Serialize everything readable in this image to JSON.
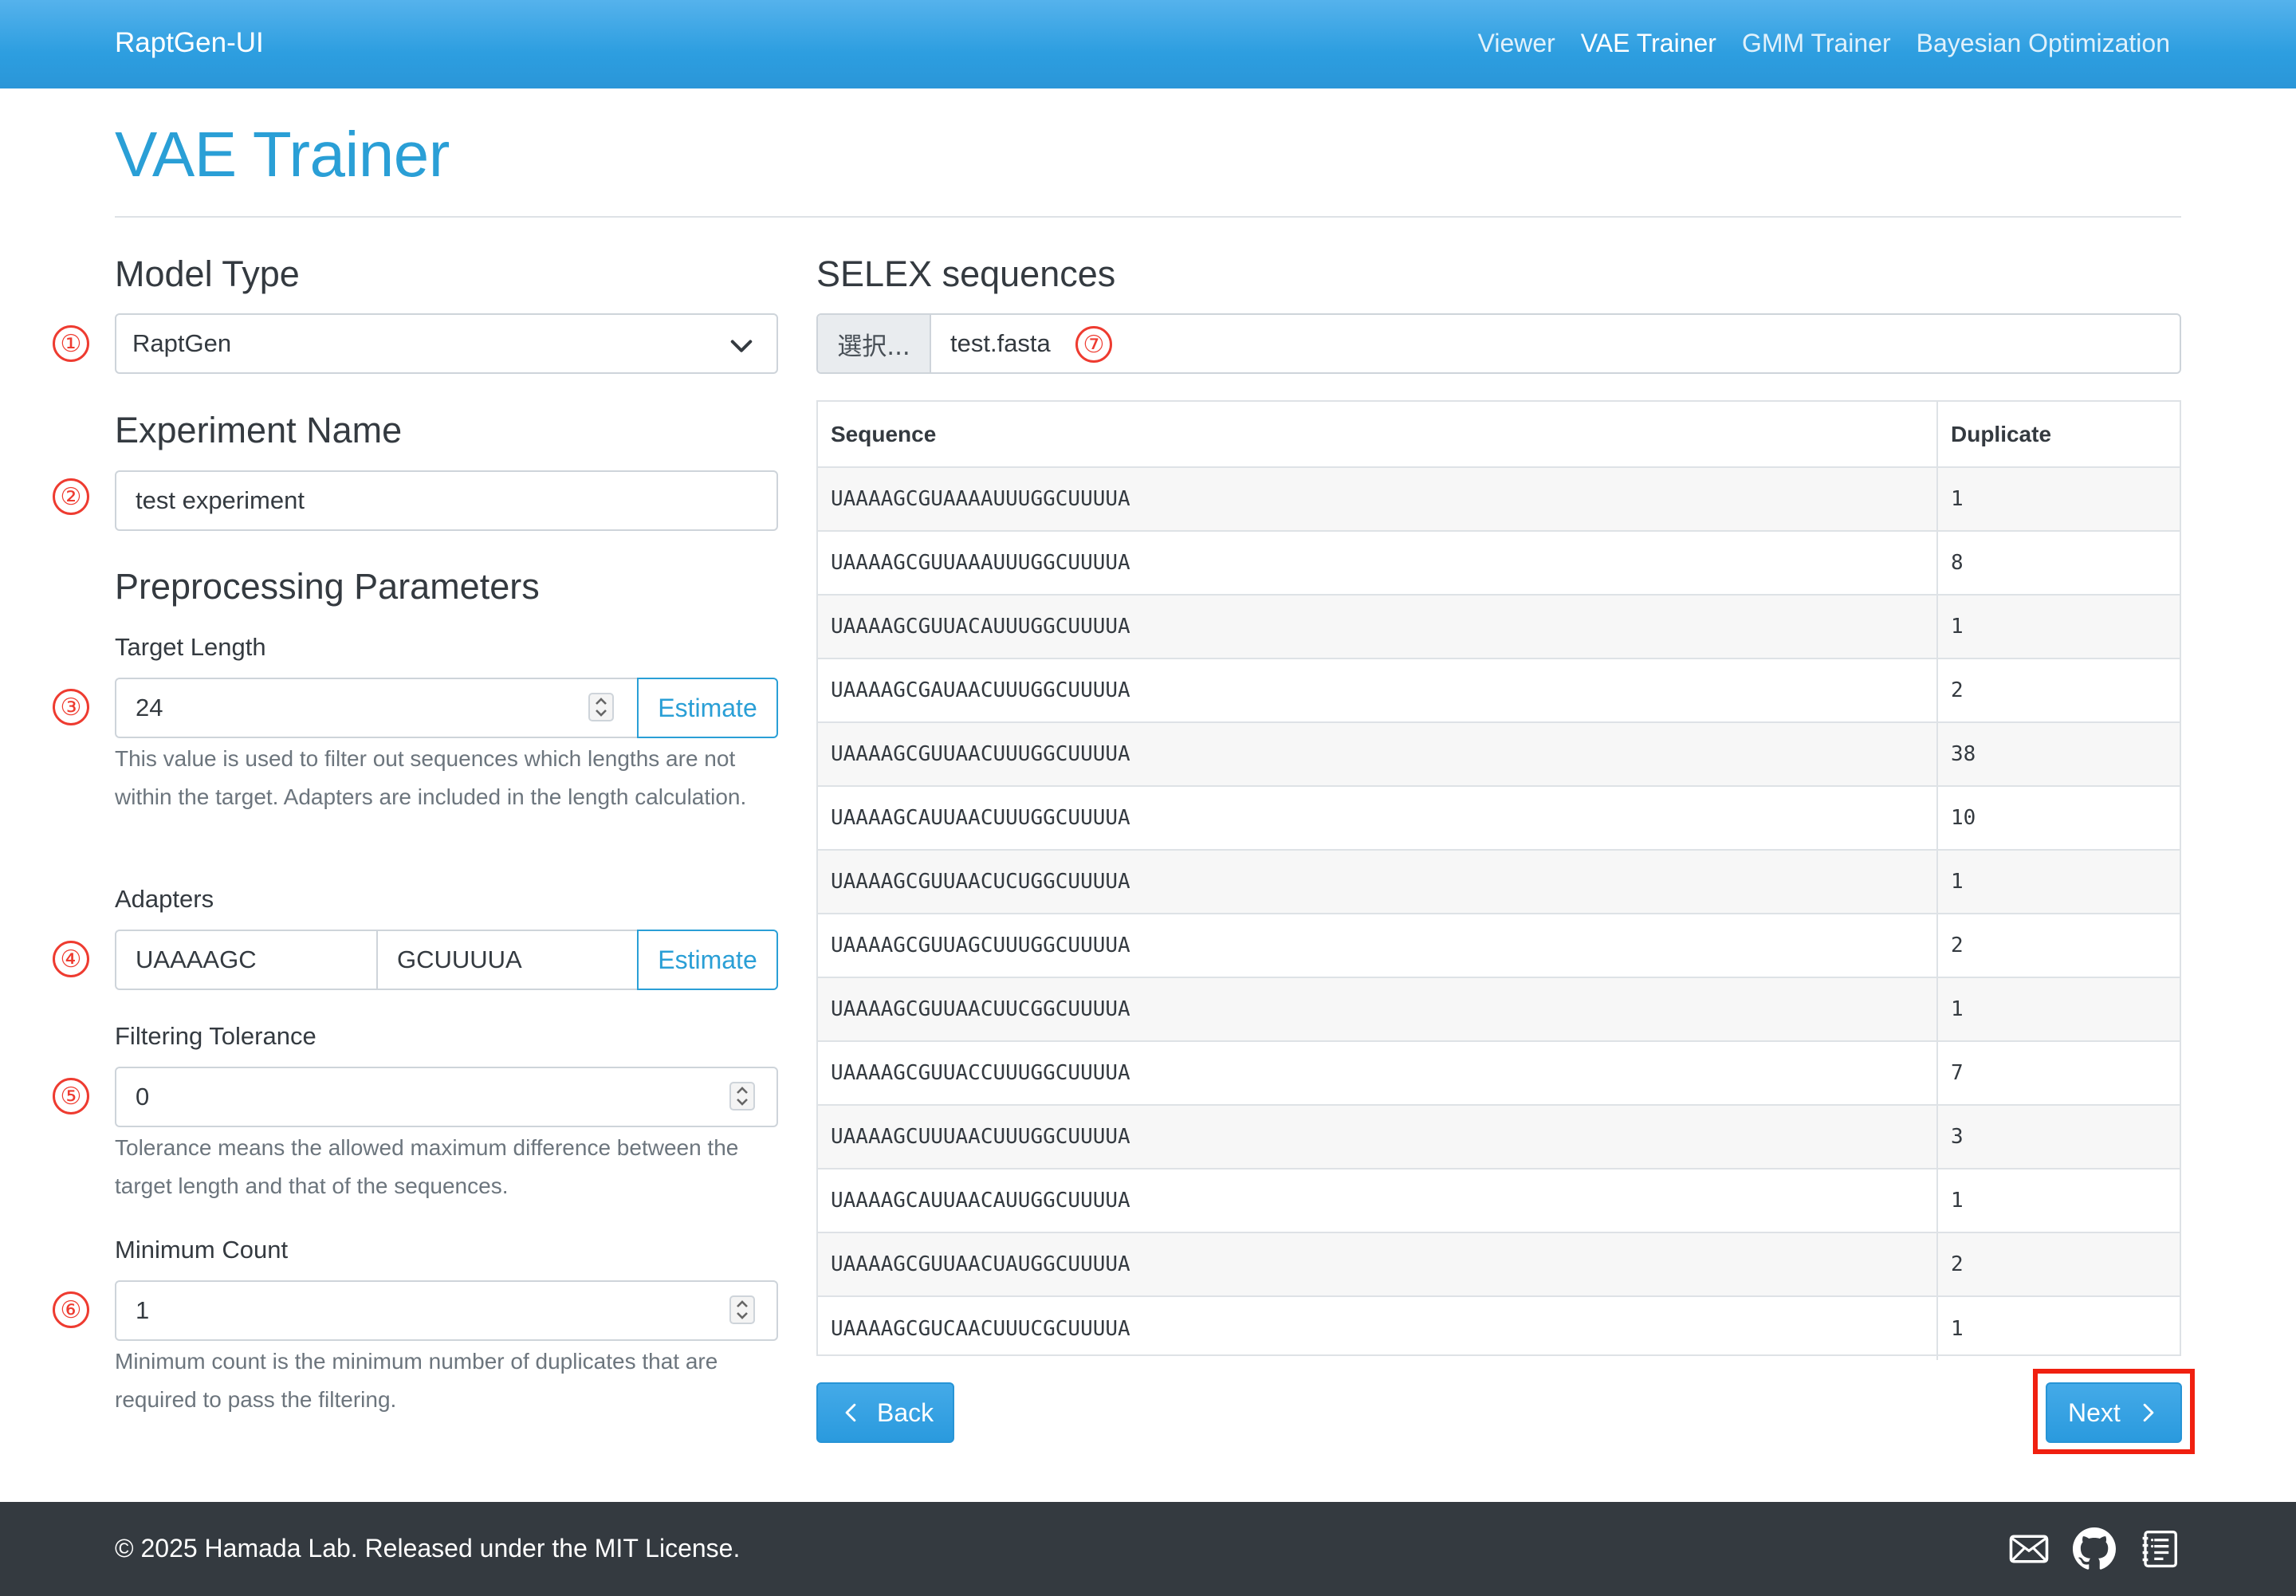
{
  "navbar": {
    "brand": "RaptGen-UI",
    "links": [
      {
        "label": "Viewer",
        "active": false
      },
      {
        "label": "VAE Trainer",
        "active": true
      },
      {
        "label": "GMM Trainer",
        "active": false
      },
      {
        "label": "Bayesian Optimization",
        "active": false
      }
    ]
  },
  "page": {
    "title": "VAE Trainer"
  },
  "markers": [
    "①",
    "②",
    "③",
    "④",
    "⑤",
    "⑥",
    "⑦"
  ],
  "model_type": {
    "heading": "Model Type",
    "selected": "RaptGen"
  },
  "experiment": {
    "heading": "Experiment Name",
    "value": "test experiment"
  },
  "preprocessing": {
    "heading": "Preprocessing Parameters",
    "target_length": {
      "label": "Target Length",
      "value": "24",
      "estimate_label": "Estimate",
      "help": "This value is used to filter out sequences which lengths are not within the target. Adapters are included in the length calculation."
    },
    "adapters": {
      "label": "Adapters",
      "forward": "UAAAAGC",
      "reverse": "GCUUUUA",
      "estimate_label": "Estimate"
    },
    "filtering_tolerance": {
      "label": "Filtering Tolerance",
      "value": "0",
      "help": "Tolerance means the allowed maximum difference between the target length and that of the sequences."
    },
    "minimum_count": {
      "label": "Minimum Count",
      "value": "1",
      "help": "Minimum count is the minimum number of duplicates that are required to pass the filtering."
    }
  },
  "selex": {
    "heading": "SELEX sequences",
    "browse_label": "選択...",
    "file_name": "test.fasta",
    "columns": [
      "Sequence",
      "Duplicate"
    ],
    "rows": [
      [
        "UAAAAGCGUAAAAUUUGGCUUUUA",
        "1"
      ],
      [
        "UAAAAGCGUUAAAUUUGGCUUUUA",
        "8"
      ],
      [
        "UAAAAGCGUUACAUUUGGCUUUUA",
        "1"
      ],
      [
        "UAAAAGCGAUAACUUUGGCUUUUA",
        "2"
      ],
      [
        "UAAAAGCGUUAACUUUGGCUUUUA",
        "38"
      ],
      [
        "UAAAAGCAUUAACUUUGGCUUUUA",
        "10"
      ],
      [
        "UAAAAGCGUUAACUCUGGCUUUUA",
        "1"
      ],
      [
        "UAAAAGCGUUAGCUUUGGCUUUUA",
        "2"
      ],
      [
        "UAAAAGCGUUAACUUCGGCUUUUA",
        "1"
      ],
      [
        "UAAAAGCGUUACCUUUGGCUUUUA",
        "7"
      ],
      [
        "UAAAAGCUUUAACUUUGGCUUUUA",
        "3"
      ],
      [
        "UAAAAGCAUUAACAUUGGCUUUUA",
        "1"
      ],
      [
        "UAAAAGCGUUAACUAUGGCUUUUA",
        "2"
      ],
      [
        "UAAAAGCGUCAACUUUCGCUUUUA",
        "1"
      ]
    ]
  },
  "actions": {
    "back_label": "Back",
    "next_label": "Next"
  },
  "footer": {
    "text": "© 2025 Hamada Lab. Released under the MIT License.",
    "icons": [
      "mail-icon",
      "github-icon",
      "document-icon"
    ]
  },
  "colors": {
    "primary": "#2a9fd6",
    "navbar": "#2d9ee0",
    "footer": "#343a40",
    "marker": "#ee3b30",
    "highlight": "#f02010"
  }
}
